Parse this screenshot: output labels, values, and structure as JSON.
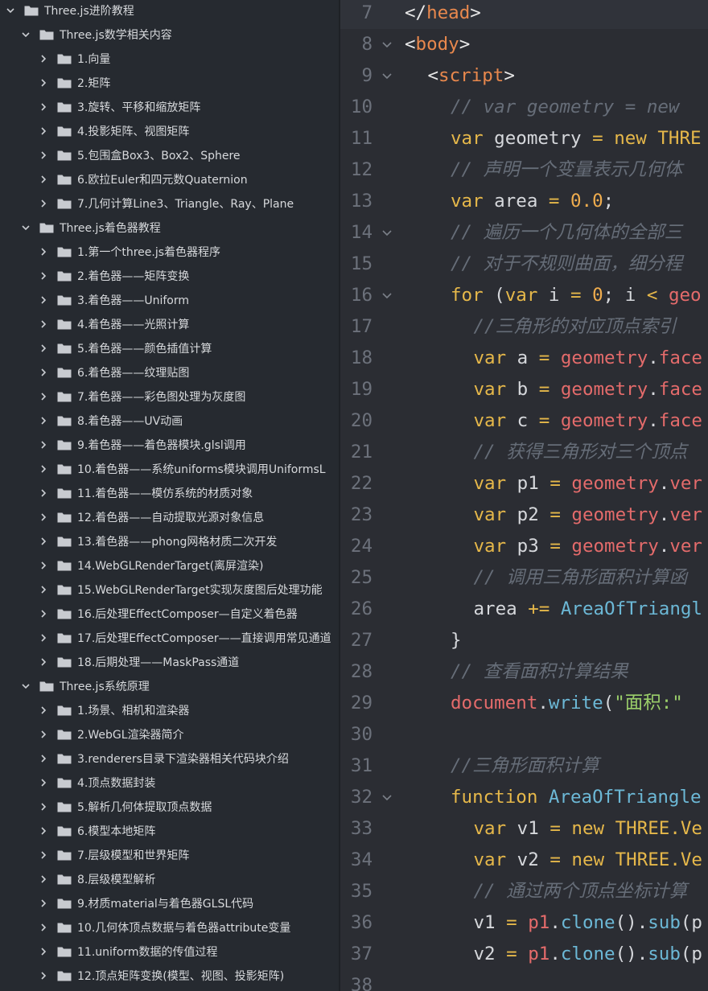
{
  "sidebar": {
    "rows": [
      {
        "level": 0,
        "expanded": true,
        "label": "Three.js进阶教程"
      },
      {
        "level": 1,
        "expanded": true,
        "label": "Three.js数学相关内容"
      },
      {
        "level": 2,
        "expanded": false,
        "label": "1.向量"
      },
      {
        "level": 2,
        "expanded": false,
        "label": "2.矩阵"
      },
      {
        "level": 2,
        "expanded": false,
        "label": "3.旋转、平移和缩放矩阵"
      },
      {
        "level": 2,
        "expanded": false,
        "label": "4.投影矩阵、视图矩阵"
      },
      {
        "level": 2,
        "expanded": false,
        "label": "5.包围盒Box3、Box2、Sphere"
      },
      {
        "level": 2,
        "expanded": false,
        "label": "6.欧拉Euler和四元数Quaternion"
      },
      {
        "level": 2,
        "expanded": false,
        "label": "7.几何计算Line3、Triangle、Ray、Plane"
      },
      {
        "level": 1,
        "expanded": true,
        "label": "Three.js着色器教程"
      },
      {
        "level": 2,
        "expanded": false,
        "label": "1.第一个three.js着色器程序"
      },
      {
        "level": 2,
        "expanded": false,
        "label": "2.着色器——矩阵变换"
      },
      {
        "level": 2,
        "expanded": false,
        "label": "3.着色器——Uniform"
      },
      {
        "level": 2,
        "expanded": false,
        "label": "4.着色器——光照计算"
      },
      {
        "level": 2,
        "expanded": false,
        "label": "5.着色器——颜色插值计算"
      },
      {
        "level": 2,
        "expanded": false,
        "label": "6.着色器——纹理贴图"
      },
      {
        "level": 2,
        "expanded": false,
        "label": "7.着色器——彩色图处理为灰度图"
      },
      {
        "level": 2,
        "expanded": false,
        "label": "8.着色器——UV动画"
      },
      {
        "level": 2,
        "expanded": false,
        "label": "9.着色器——着色器模块.glsl调用"
      },
      {
        "level": 2,
        "expanded": false,
        "label": "10.着色器——系统uniforms模块调用UniformsL"
      },
      {
        "level": 2,
        "expanded": false,
        "label": "11.着色器——模仿系统的材质对象"
      },
      {
        "level": 2,
        "expanded": false,
        "label": "12.着色器——自动提取光源对象信息"
      },
      {
        "level": 2,
        "expanded": false,
        "label": "13.着色器——phong网格材质二次开发"
      },
      {
        "level": 2,
        "expanded": false,
        "label": "14.WebGLRenderTarget(离屏渲染)"
      },
      {
        "level": 2,
        "expanded": false,
        "label": "15.WebGLRenderTarget实现灰度图后处理功能"
      },
      {
        "level": 2,
        "expanded": false,
        "label": "16.后处理EffectComposer—自定义着色器"
      },
      {
        "level": 2,
        "expanded": false,
        "label": "17.后处理EffectComposer——直接调用常见通道"
      },
      {
        "level": 2,
        "expanded": false,
        "label": "18.后期处理——MaskPass通道"
      },
      {
        "level": 1,
        "expanded": true,
        "label": "Three.js系统原理"
      },
      {
        "level": 2,
        "expanded": false,
        "label": "1.场景、相机和渲染器"
      },
      {
        "level": 2,
        "expanded": false,
        "label": "2.WebGL渲染器简介"
      },
      {
        "level": 2,
        "expanded": false,
        "label": "3.renderers目录下渲染器相关代码块介绍"
      },
      {
        "level": 2,
        "expanded": false,
        "label": "4.顶点数据封装"
      },
      {
        "level": 2,
        "expanded": false,
        "label": "5.解析几何体提取顶点数据"
      },
      {
        "level": 2,
        "expanded": false,
        "label": "6.模型本地矩阵"
      },
      {
        "level": 2,
        "expanded": false,
        "label": "7.层级模型和世界矩阵"
      },
      {
        "level": 2,
        "expanded": false,
        "label": "8.层级模型解析"
      },
      {
        "level": 2,
        "expanded": false,
        "label": "9.材质material与着色器GLSL代码"
      },
      {
        "level": 2,
        "expanded": false,
        "label": "10.几何体顶点数据与着色器attribute变量"
      },
      {
        "level": 2,
        "expanded": false,
        "label": "11.uniform数据的传值过程"
      },
      {
        "level": 2,
        "expanded": false,
        "label": "12.顶点矩阵变换(模型、视图、投影矩阵)"
      }
    ]
  },
  "editor": {
    "lines": [
      {
        "n": "7",
        "fold": false,
        "indent": 0,
        "tokens": [
          [
            "tag",
            "</"
          ],
          [
            "tagname",
            "head"
          ],
          [
            "tag",
            ">"
          ]
        ]
      },
      {
        "n": "8",
        "fold": true,
        "indent": 0,
        "tokens": [
          [
            "tag",
            "<"
          ],
          [
            "tagname",
            "body"
          ],
          [
            "tag",
            ">"
          ]
        ]
      },
      {
        "n": "9",
        "fold": true,
        "indent": 1,
        "tokens": [
          [
            "tag",
            "<"
          ],
          [
            "tagname",
            "script"
          ],
          [
            "tag",
            ">"
          ]
        ]
      },
      {
        "n": "10",
        "fold": false,
        "indent": 2,
        "tokens": [
          [
            "cmt",
            "// var geometry = new"
          ]
        ]
      },
      {
        "n": "11",
        "fold": false,
        "indent": 2,
        "tokens": [
          [
            "kw",
            "var"
          ],
          [
            "plain",
            " geometry "
          ],
          [
            "kw",
            "="
          ],
          [
            "plain",
            " "
          ],
          [
            "kw",
            "new"
          ],
          [
            "plain",
            " "
          ],
          [
            "cls",
            "THRE"
          ]
        ]
      },
      {
        "n": "12",
        "fold": false,
        "indent": 2,
        "tokens": [
          [
            "cmt",
            "// 声明一个变量表示几何体"
          ]
        ]
      },
      {
        "n": "13",
        "fold": false,
        "indent": 2,
        "tokens": [
          [
            "kw",
            "var"
          ],
          [
            "plain",
            " area "
          ],
          [
            "kw",
            "="
          ],
          [
            "plain",
            " "
          ],
          [
            "num",
            "0.0"
          ],
          [
            "plain",
            ";"
          ]
        ]
      },
      {
        "n": "14",
        "fold": true,
        "indent": 2,
        "tokens": [
          [
            "cmt",
            "// 遍历一个几何体的全部三"
          ]
        ]
      },
      {
        "n": "15",
        "fold": false,
        "indent": 2,
        "tokens": [
          [
            "cmt",
            "// 对于不规则曲面，细分程"
          ]
        ]
      },
      {
        "n": "16",
        "fold": true,
        "indent": 2,
        "tokens": [
          [
            "kw",
            "for"
          ],
          [
            "plain",
            " ("
          ],
          [
            "kw",
            "var"
          ],
          [
            "plain",
            " i "
          ],
          [
            "kw",
            "="
          ],
          [
            "plain",
            " "
          ],
          [
            "num",
            "0"
          ],
          [
            "plain",
            "; i "
          ],
          [
            "kw",
            "<"
          ],
          [
            "plain",
            " "
          ],
          [
            "obj",
            "geo"
          ]
        ]
      },
      {
        "n": "17",
        "fold": false,
        "indent": 3,
        "tokens": [
          [
            "cmt",
            "//三角形的对应顶点索引"
          ]
        ]
      },
      {
        "n": "18",
        "fold": false,
        "indent": 3,
        "tokens": [
          [
            "kw",
            "var"
          ],
          [
            "plain",
            " a "
          ],
          [
            "kw",
            "="
          ],
          [
            "plain",
            " "
          ],
          [
            "obj",
            "geometry"
          ],
          [
            "plain",
            "."
          ],
          [
            "obj",
            "face"
          ]
        ]
      },
      {
        "n": "19",
        "fold": false,
        "indent": 3,
        "tokens": [
          [
            "kw",
            "var"
          ],
          [
            "plain",
            " b "
          ],
          [
            "kw",
            "="
          ],
          [
            "plain",
            " "
          ],
          [
            "obj",
            "geometry"
          ],
          [
            "plain",
            "."
          ],
          [
            "obj",
            "face"
          ]
        ]
      },
      {
        "n": "20",
        "fold": false,
        "indent": 3,
        "tokens": [
          [
            "kw",
            "var"
          ],
          [
            "plain",
            " c "
          ],
          [
            "kw",
            "="
          ],
          [
            "plain",
            " "
          ],
          [
            "obj",
            "geometry"
          ],
          [
            "plain",
            "."
          ],
          [
            "obj",
            "face"
          ]
        ]
      },
      {
        "n": "21",
        "fold": false,
        "indent": 3,
        "tokens": [
          [
            "cmt",
            "// 获得三角形对三个顶点"
          ]
        ]
      },
      {
        "n": "22",
        "fold": false,
        "indent": 3,
        "tokens": [
          [
            "kw",
            "var"
          ],
          [
            "plain",
            " p1 "
          ],
          [
            "kw",
            "="
          ],
          [
            "plain",
            " "
          ],
          [
            "obj",
            "geometry"
          ],
          [
            "plain",
            "."
          ],
          [
            "obj",
            "ver"
          ]
        ]
      },
      {
        "n": "23",
        "fold": false,
        "indent": 3,
        "tokens": [
          [
            "kw",
            "var"
          ],
          [
            "plain",
            " p2 "
          ],
          [
            "kw",
            "="
          ],
          [
            "plain",
            " "
          ],
          [
            "obj",
            "geometry"
          ],
          [
            "plain",
            "."
          ],
          [
            "obj",
            "ver"
          ]
        ]
      },
      {
        "n": "24",
        "fold": false,
        "indent": 3,
        "tokens": [
          [
            "kw",
            "var"
          ],
          [
            "plain",
            " p3 "
          ],
          [
            "kw",
            "="
          ],
          [
            "plain",
            " "
          ],
          [
            "obj",
            "geometry"
          ],
          [
            "plain",
            "."
          ],
          [
            "obj",
            "ver"
          ]
        ]
      },
      {
        "n": "25",
        "fold": false,
        "indent": 3,
        "tokens": [
          [
            "cmt",
            "// 调用三角形面积计算函"
          ]
        ]
      },
      {
        "n": "26",
        "fold": false,
        "indent": 3,
        "tokens": [
          [
            "plain",
            "area "
          ],
          [
            "kw",
            "+="
          ],
          [
            "plain",
            " "
          ],
          [
            "fn",
            "AreaOfTriangl"
          ]
        ]
      },
      {
        "n": "27",
        "fold": false,
        "indent": 2,
        "tokens": [
          [
            "plain",
            "}"
          ]
        ]
      },
      {
        "n": "28",
        "fold": false,
        "indent": 2,
        "tokens": [
          [
            "cmt",
            "// 查看面积计算结果"
          ]
        ]
      },
      {
        "n": "29",
        "fold": false,
        "indent": 2,
        "tokens": [
          [
            "obj",
            "document"
          ],
          [
            "plain",
            "."
          ],
          [
            "call",
            "write"
          ],
          [
            "plain",
            "("
          ],
          [
            "str",
            "\"面积:\""
          ]
        ]
      },
      {
        "n": "30",
        "fold": false,
        "indent": 0,
        "tokens": []
      },
      {
        "n": "31",
        "fold": false,
        "indent": 2,
        "tokens": [
          [
            "cmt",
            "//三角形面积计算"
          ]
        ]
      },
      {
        "n": "32",
        "fold": true,
        "indent": 2,
        "tokens": [
          [
            "kw",
            "function"
          ],
          [
            "plain",
            " "
          ],
          [
            "fn",
            "AreaOfTriangle"
          ]
        ]
      },
      {
        "n": "33",
        "fold": false,
        "indent": 3,
        "tokens": [
          [
            "kw",
            "var"
          ],
          [
            "plain",
            " v1 "
          ],
          [
            "kw",
            "="
          ],
          [
            "plain",
            " "
          ],
          [
            "kw",
            "new"
          ],
          [
            "plain",
            " "
          ],
          [
            "cls",
            "THREE.Ve"
          ]
        ]
      },
      {
        "n": "34",
        "fold": false,
        "indent": 3,
        "tokens": [
          [
            "kw",
            "var"
          ],
          [
            "plain",
            " v2 "
          ],
          [
            "kw",
            "="
          ],
          [
            "plain",
            " "
          ],
          [
            "kw",
            "new"
          ],
          [
            "plain",
            " "
          ],
          [
            "cls",
            "THREE.Ve"
          ]
        ]
      },
      {
        "n": "35",
        "fold": false,
        "indent": 3,
        "tokens": [
          [
            "cmt",
            "// 通过两个顶点坐标计算"
          ]
        ]
      },
      {
        "n": "36",
        "fold": false,
        "indent": 3,
        "tokens": [
          [
            "plain",
            "v1 "
          ],
          [
            "kw",
            "="
          ],
          [
            "plain",
            " "
          ],
          [
            "obj",
            "p1"
          ],
          [
            "plain",
            "."
          ],
          [
            "call",
            "clone"
          ],
          [
            "plain",
            "()."
          ],
          [
            "call",
            "sub"
          ],
          [
            "plain",
            "(p"
          ]
        ]
      },
      {
        "n": "37",
        "fold": false,
        "indent": 3,
        "tokens": [
          [
            "plain",
            "v2 "
          ],
          [
            "kw",
            "="
          ],
          [
            "plain",
            " "
          ],
          [
            "obj",
            "p1"
          ],
          [
            "plain",
            "."
          ],
          [
            "call",
            "clone"
          ],
          [
            "plain",
            "()."
          ],
          [
            "call",
            "sub"
          ],
          [
            "plain",
            "(p"
          ]
        ]
      },
      {
        "n": "38",
        "fold": false,
        "indent": 0,
        "tokens": []
      }
    ]
  }
}
